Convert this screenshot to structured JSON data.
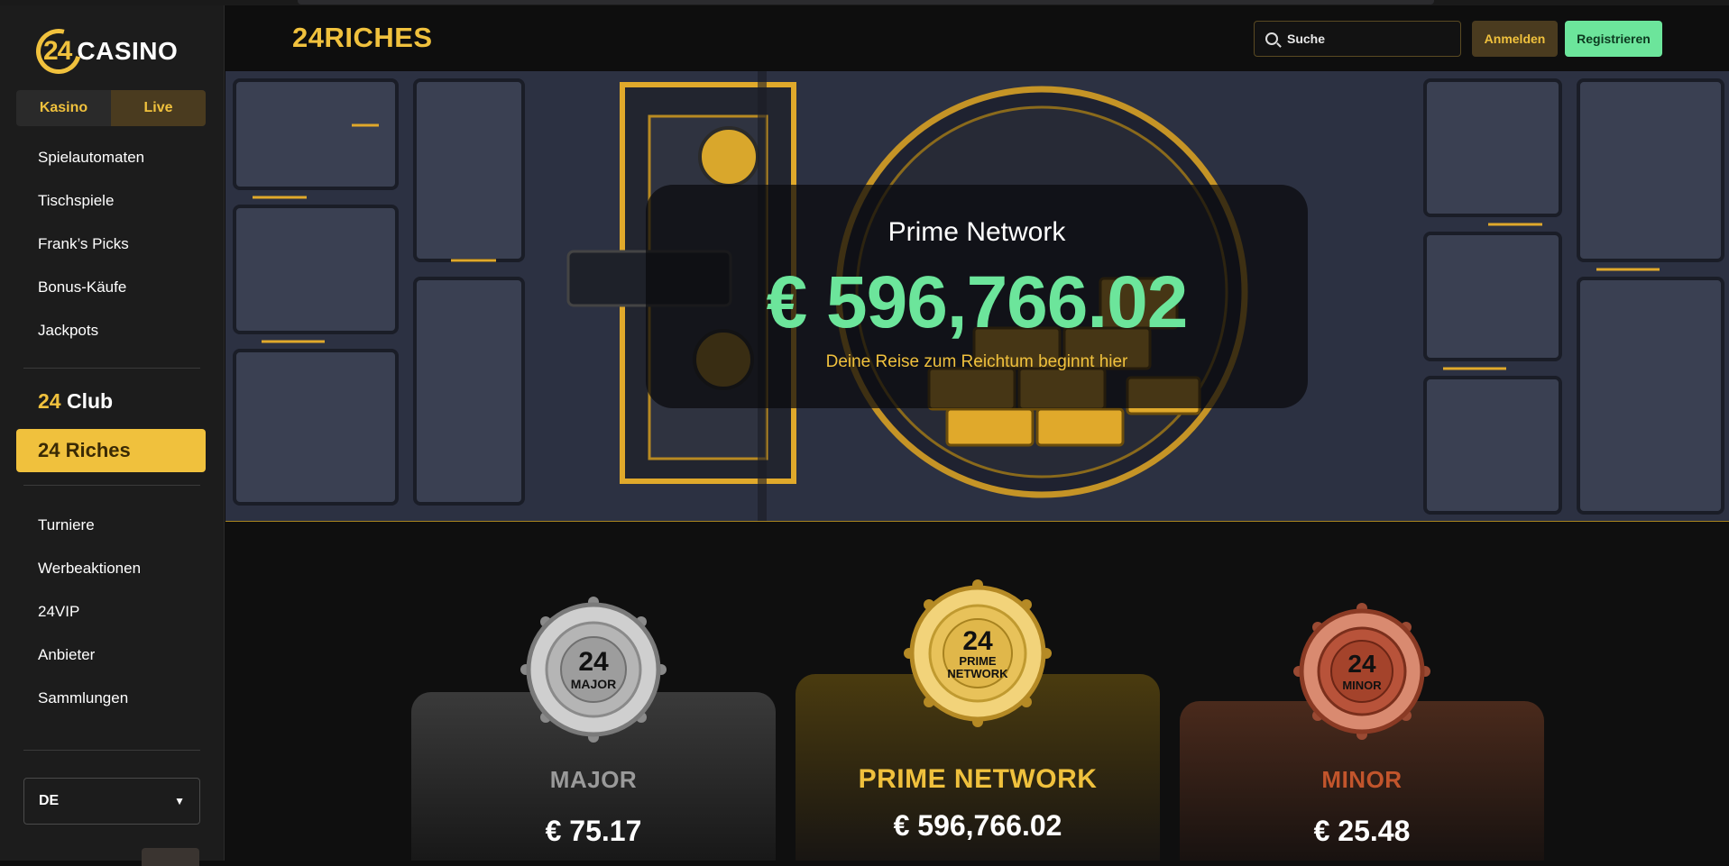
{
  "sidebar": {
    "logo_number": "24",
    "logo_text": "CASINO",
    "switch": {
      "casino": "Kasino",
      "live": "Live"
    },
    "nav_primary": [
      "Spielautomaten",
      "Tischspiele",
      "Frank’s Picks",
      "Bonus-Käufe",
      "Jackpots"
    ],
    "club": {
      "num": "24",
      "label": "Club"
    },
    "riches_button": "24 Riches",
    "nav_secondary": [
      "Turniere",
      "Werbeaktionen",
      "24VIP",
      "Anbieter",
      "Sammlungen"
    ],
    "language": "DE"
  },
  "header": {
    "brand": "24RICHES",
    "search_placeholder": "Suche",
    "login": "Anmelden",
    "register": "Registrieren"
  },
  "hero": {
    "title": "Prime Network",
    "amount": "€ 596,766.02",
    "subtitle": "Deine Reise zum Reichtum beginnt hier"
  },
  "jackpots": [
    {
      "name": "MAJOR",
      "value": "€ 75.17",
      "coin_num": "24",
      "coin_label": "MAJOR",
      "color": "#9a9a9a"
    },
    {
      "name": "PRIME NETWORK",
      "value": "€ 596,766.02",
      "coin_num": "24",
      "coin_label_1": "PRIME",
      "coin_label_2": "NETWORK",
      "color": "#f0c13d"
    },
    {
      "name": "MINOR",
      "value": "€ 25.48",
      "coin_num": "24",
      "coin_label": "MINOR",
      "color": "#c2552c"
    }
  ],
  "colors": {
    "accent": "#f0c13d",
    "green": "#6ce59b",
    "bg": "#0e0e0e"
  }
}
